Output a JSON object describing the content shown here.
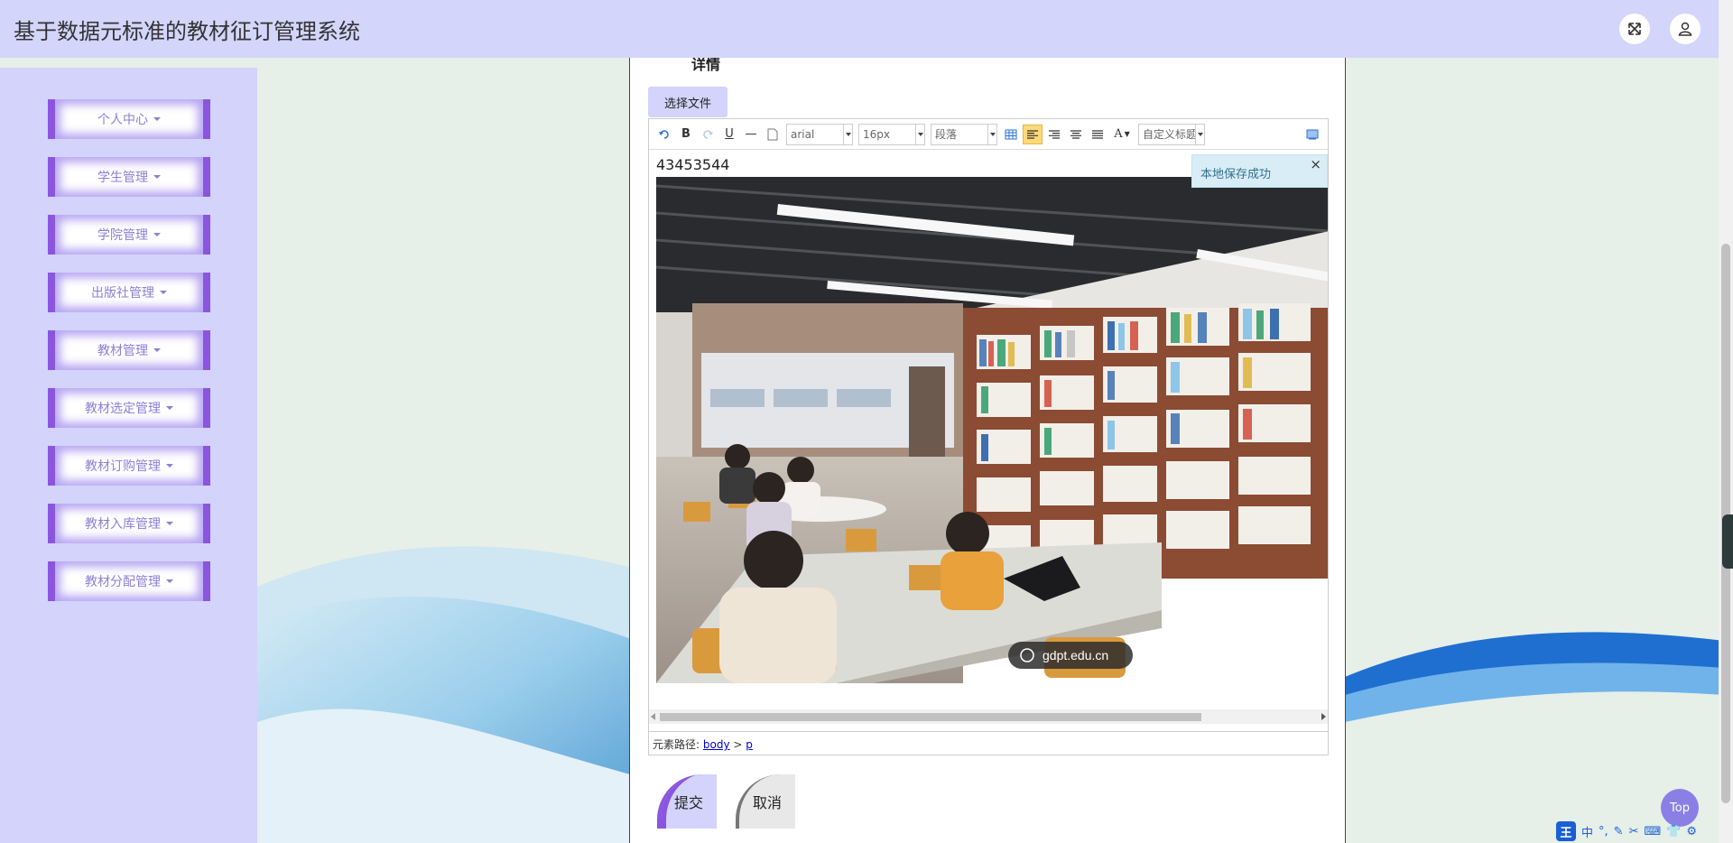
{
  "app": {
    "title": "基于数据元标准的教材征订管理系统"
  },
  "header": {
    "fullscreen_icon": "fullscreen-icon",
    "user_icon": "user-icon"
  },
  "sidebar": {
    "items": [
      {
        "label": "个人中心"
      },
      {
        "label": "学生管理"
      },
      {
        "label": "学院管理"
      },
      {
        "label": "出版社管理"
      },
      {
        "label": "教材管理"
      },
      {
        "label": "教材选定管理"
      },
      {
        "label": "教材订购管理"
      },
      {
        "label": "教材入库管理"
      },
      {
        "label": "教材分配管理"
      }
    ]
  },
  "form": {
    "detail_label": "详情",
    "choose_file_label": "选择文件"
  },
  "editor": {
    "toolbar": {
      "bold": "B",
      "underline": "U",
      "hr": "—",
      "font_family": "arial",
      "font_size": "16px",
      "paragraph": "段落",
      "font_color": "A",
      "custom_title": "自定义标题"
    },
    "content_text": "43453544",
    "image_watermark": "gdpt.edu.cn",
    "toast": "本地保存成功",
    "toast_close": "×",
    "element_path_label": "元素路径:",
    "element_path_body": "body",
    "element_path_sep": ">",
    "element_path_p": "p"
  },
  "buttons": {
    "submit": "提交",
    "cancel": "取消"
  },
  "top_button": "Top",
  "ime": {
    "logo": "王",
    "mode": "中"
  }
}
